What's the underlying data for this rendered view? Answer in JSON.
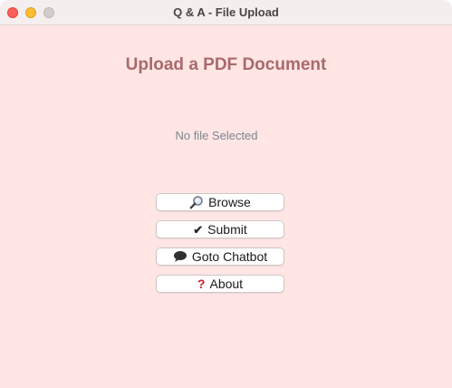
{
  "window": {
    "title": "Q & A - File Upload"
  },
  "main": {
    "heading": "Upload a PDF Document",
    "status": "No file Selected"
  },
  "buttons": {
    "browse": {
      "label": "Browse",
      "icon": "magnifying-glass-icon"
    },
    "submit": {
      "label": "Submit",
      "icon": "check-mark-icon"
    },
    "chatbot": {
      "label": "Goto Chatbot",
      "icon": "speech-bubble-icon"
    },
    "about": {
      "label": "About",
      "icon": "question-mark-icon"
    }
  },
  "colors": {
    "background": "#ffe6e5",
    "heading": "#a96a6b",
    "status": "#7d8590"
  }
}
